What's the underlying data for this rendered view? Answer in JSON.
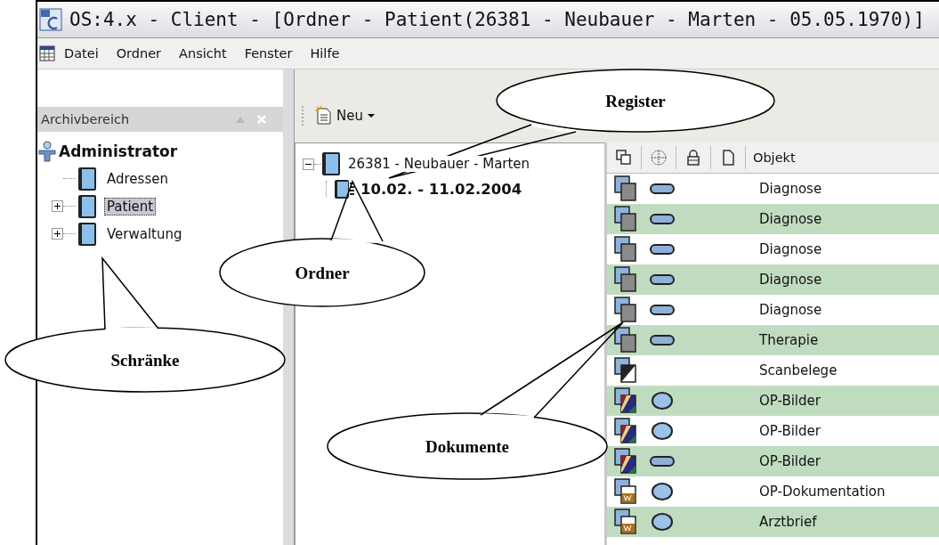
{
  "window": {
    "title": "OS:4.x - Client - [Ordner - Patient(26381 - Neubauer - Marten - 05.05.1970)]"
  },
  "menu": [
    "Datei",
    "Ordner",
    "Ansicht",
    "Fenster",
    "Hilfe"
  ],
  "archive_panel": {
    "title": "Archivbereich",
    "tree": [
      {
        "label": "Administrator",
        "kind": "user",
        "children": [
          {
            "label": "Adressen",
            "kind": "cabinet",
            "expandable": false,
            "selected": false
          },
          {
            "label": "Patient",
            "kind": "cabinet",
            "expandable": true,
            "selected": true
          },
          {
            "label": "Verwaltung",
            "kind": "cabinet",
            "expandable": true,
            "selected": false
          }
        ]
      }
    ]
  },
  "toolbar": {
    "new_button": "Neu"
  },
  "folder_tree": [
    {
      "label": "26381 - Neubauer - Marten",
      "kind": "folder",
      "expanded": true,
      "children": [
        {
          "label": "10.02. - 11.02.2004",
          "kind": "register"
        }
      ]
    }
  ],
  "document_list": {
    "columns": [
      {
        "kind": "icon"
      },
      {
        "kind": "icon"
      },
      {
        "kind": "icon"
      },
      {
        "kind": "icon"
      },
      {
        "kind": "text",
        "label": "Objekt"
      }
    ],
    "rows": [
      {
        "kind": "plain",
        "status": {
          "kind": "bar"
        },
        "object": "Diagnose"
      },
      {
        "kind": "plain",
        "status": {
          "kind": "bar"
        },
        "object": "Diagnose"
      },
      {
        "kind": "plain",
        "status": {
          "kind": "bar"
        },
        "object": "Diagnose"
      },
      {
        "kind": "plain",
        "status": {
          "kind": "bar"
        },
        "object": "Diagnose"
      },
      {
        "kind": "plain",
        "status": {
          "kind": "bar"
        },
        "object": "Diagnose"
      },
      {
        "kind": "plain",
        "status": {
          "kind": "bar"
        },
        "object": "Therapie"
      },
      {
        "kind": "scan",
        "object": "Scanbelege"
      },
      {
        "kind": "image",
        "status": {
          "kind": "oval"
        },
        "object": "OP-Bilder"
      },
      {
        "kind": "image",
        "status": {
          "kind": "oval"
        },
        "object": "OP-Bilder"
      },
      {
        "kind": "image",
        "status": {
          "kind": "bar"
        },
        "object": "OP-Bilder"
      },
      {
        "kind": "text",
        "status": {
          "kind": "oval"
        },
        "object": "OP-Dokumentation"
      },
      {
        "kind": "text",
        "status": {
          "kind": "oval"
        },
        "object": "Arztbrief"
      }
    ]
  },
  "callouts": [
    {
      "label": "Register"
    },
    {
      "label": "Ordner"
    },
    {
      "label": "Schränke"
    },
    {
      "label": "Dokumente"
    }
  ]
}
